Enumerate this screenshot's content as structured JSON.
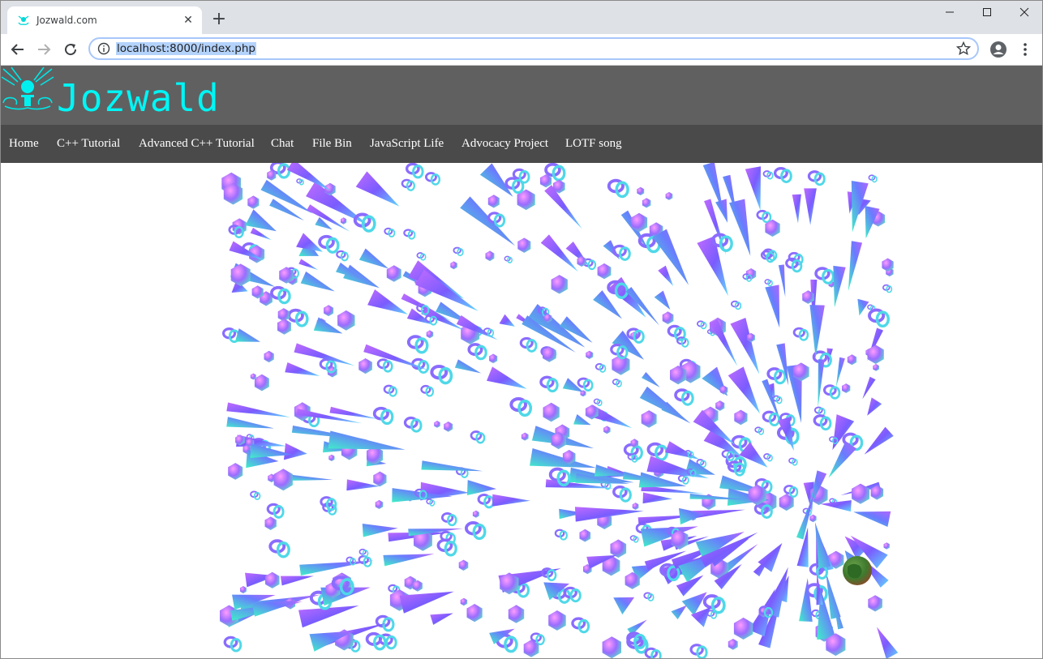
{
  "browser": {
    "tab_title": "Jozwald.com",
    "url": "localhost:8000/index.php",
    "tab_close_icon": "close-icon",
    "new_tab_icon": "plus-icon",
    "window_controls": [
      "minimize-icon",
      "maximize-icon",
      "close-icon"
    ]
  },
  "site": {
    "title": "Jozwald",
    "title_color": "#00f5f5",
    "header_color": "#606060",
    "nav_color": "#4a4a4a",
    "nav": [
      {
        "label": "Home"
      },
      {
        "label": "C++ Tutorial"
      },
      {
        "label": "Advanced C++ Tutorial"
      },
      {
        "label": "Chat"
      },
      {
        "label": "File Bin"
      },
      {
        "label": "JavaScript Life"
      },
      {
        "label": "Advocacy Project"
      },
      {
        "label": "LOTF song"
      }
    ]
  },
  "scene": {
    "description_shapes": [
      "cone",
      "hexagon",
      "torus-knot",
      "planet"
    ],
    "colors": [
      "#7a5cff",
      "#b266ff",
      "#5fd0ff",
      "#3ff0c8",
      "#ff66ff",
      "#9a4dff"
    ]
  }
}
